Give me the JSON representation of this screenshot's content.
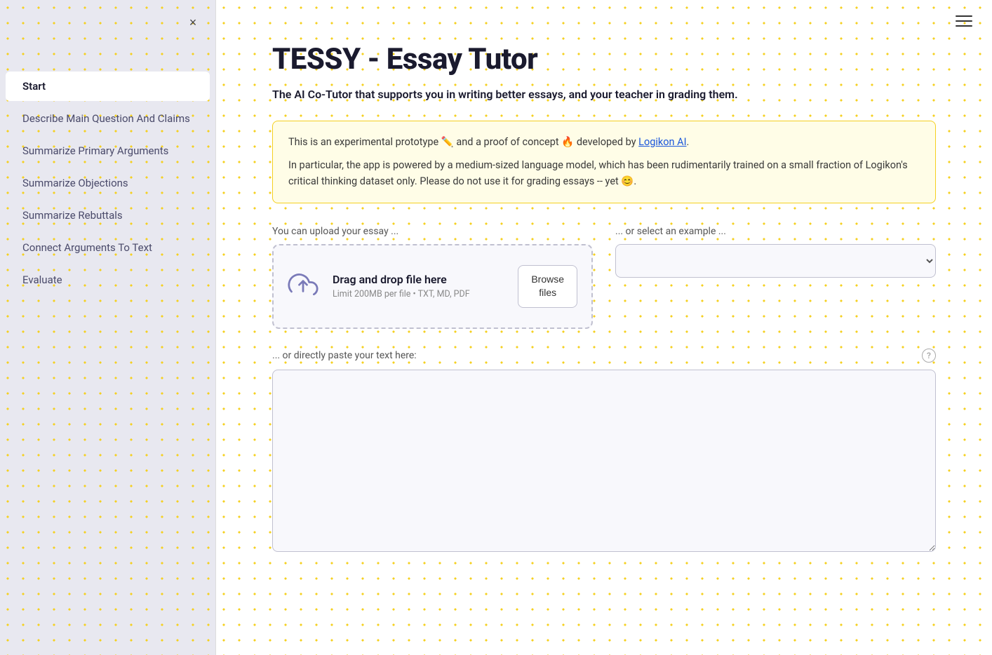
{
  "sidebar": {
    "close_label": "×",
    "items": [
      {
        "id": "start",
        "label": "Start",
        "active": true
      },
      {
        "id": "describe",
        "label": "Describe Main Question And Claims",
        "active": false
      },
      {
        "id": "summarize-primary",
        "label": "Summarize Primary Arguments",
        "active": false
      },
      {
        "id": "summarize-objections",
        "label": "Summarize Objections",
        "active": false
      },
      {
        "id": "summarize-rebuttals",
        "label": "Summarize Rebuttals",
        "active": false
      },
      {
        "id": "connect-arguments",
        "label": "Connect Arguments To Text",
        "active": false
      },
      {
        "id": "evaluate",
        "label": "Evaluate",
        "active": false
      }
    ]
  },
  "header": {
    "hamburger_label": "☰"
  },
  "main": {
    "title": "TESSY - Essay Tutor",
    "subtitle": "The AI Co-Tutor that supports you in writing better essays, and your teacher in grading them.",
    "info_line1": "This is an experimental prototype ✏️ and a proof of concept 🔥 developed by Logikon AI.",
    "info_line1_prefix": "This is an experimental prototype ✏️ and a proof of concept 🔥 developed by ",
    "info_link_text": "Logikon AI",
    "info_line1_suffix": ".",
    "info_line2": "In particular, the app is powered by a medium-sized language model, which has been rudimentarily trained on a small fraction of Logikon's critical thinking dataset only. Please do not use it for grading essays -- yet 😊.",
    "upload_label": "You can upload your essay ...",
    "dropzone_title": "Drag and drop file here",
    "dropzone_hint": "Limit 200MB per file • TXT, MD, PDF",
    "browse_label": "Browse\nfiles",
    "example_label": "... or select an example ...",
    "example_placeholder": "",
    "paste_label": "... or directly paste your text here:",
    "help_icon": "?",
    "textarea_placeholder": ""
  }
}
